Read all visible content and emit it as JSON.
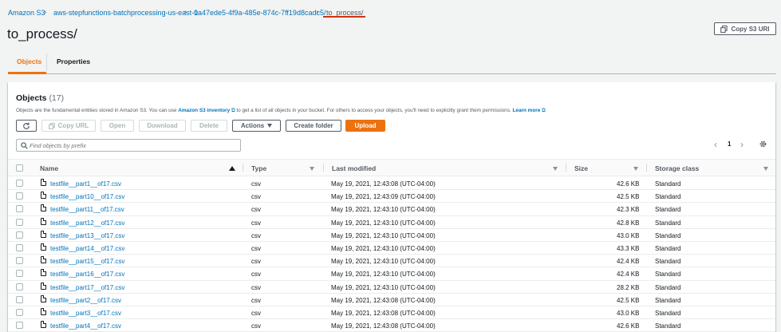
{
  "breadcrumb": {
    "items": [
      "Amazon S3",
      "aws-stepfunctions-batchprocessing-us-east-1",
      "0a47ede5-4f9a-485e-874c-7ff19d8cadc5/"
    ],
    "current": "to_process/"
  },
  "page": {
    "title": "to_process/",
    "copy_uri_label": "Copy S3 URI"
  },
  "tabs": [
    {
      "label": "Objects",
      "active": true
    },
    {
      "label": "Properties",
      "active": false
    }
  ],
  "objects": {
    "heading": "Objects",
    "count": "(17)",
    "description_pre": "Objects are the fundamental entities stored in Amazon S3. You can use",
    "inventory_link": "Amazon S3 inventory",
    "description_post": "to get a list of all objects in your bucket. For others to access your objects, you'll need to explicitly grant them permissions.",
    "learn_more": "Learn more",
    "toolbar": {
      "copy_url": "Copy URL",
      "open": "Open",
      "download": "Download",
      "delete": "Delete",
      "actions": "Actions",
      "create_folder": "Create folder",
      "upload": "Upload"
    },
    "search_placeholder": "Find objects by prefix",
    "pagination": {
      "current_page": "1"
    },
    "columns": {
      "name": "Name",
      "type": "Type",
      "last_modified": "Last modified",
      "size": "Size",
      "storage_class": "Storage class"
    },
    "rows": [
      {
        "name": "testfile__part1__of17.csv",
        "type": "csv",
        "modified": "May 19, 2021, 12:43:08 (UTC-04:00)",
        "size": "42.6 KB",
        "storage": "Standard"
      },
      {
        "name": "testfile__part10__of17.csv",
        "type": "csv",
        "modified": "May 19, 2021, 12:43:09 (UTC-04:00)",
        "size": "42.5 KB",
        "storage": "Standard"
      },
      {
        "name": "testfile__part11__of17.csv",
        "type": "csv",
        "modified": "May 19, 2021, 12:43:10 (UTC-04:00)",
        "size": "42.3 KB",
        "storage": "Standard"
      },
      {
        "name": "testfile__part12__of17.csv",
        "type": "csv",
        "modified": "May 19, 2021, 12:43:10 (UTC-04:00)",
        "size": "42.8 KB",
        "storage": "Standard"
      },
      {
        "name": "testfile__part13__of17.csv",
        "type": "csv",
        "modified": "May 19, 2021, 12:43:10 (UTC-04:00)",
        "size": "43.0 KB",
        "storage": "Standard"
      },
      {
        "name": "testfile__part14__of17.csv",
        "type": "csv",
        "modified": "May 19, 2021, 12:43:10 (UTC-04:00)",
        "size": "43.3 KB",
        "storage": "Standard"
      },
      {
        "name": "testfile__part15__of17.csv",
        "type": "csv",
        "modified": "May 19, 2021, 12:43:10 (UTC-04:00)",
        "size": "42.4 KB",
        "storage": "Standard"
      },
      {
        "name": "testfile__part16__of17.csv",
        "type": "csv",
        "modified": "May 19, 2021, 12:43:10 (UTC-04:00)",
        "size": "42.4 KB",
        "storage": "Standard"
      },
      {
        "name": "testfile__part17__of17.csv",
        "type": "csv",
        "modified": "May 19, 2021, 12:43:10 (UTC-04:00)",
        "size": "28.2 KB",
        "storage": "Standard"
      },
      {
        "name": "testfile__part2__of17.csv",
        "type": "csv",
        "modified": "May 19, 2021, 12:43:08 (UTC-04:00)",
        "size": "42.5 KB",
        "storage": "Standard"
      },
      {
        "name": "testfile__part3__of17.csv",
        "type": "csv",
        "modified": "May 19, 2021, 12:43:08 (UTC-04:00)",
        "size": "43.0 KB",
        "storage": "Standard"
      },
      {
        "name": "testfile__part4__of17.csv",
        "type": "csv",
        "modified": "May 19, 2021, 12:43:08 (UTC-04:00)",
        "size": "42.6 KB",
        "storage": "Standard"
      }
    ]
  }
}
